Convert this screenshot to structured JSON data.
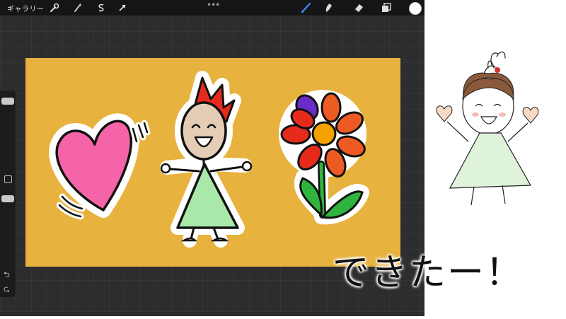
{
  "topbar": {
    "gallery_label": "ギャラリー",
    "dots": "•••",
    "left_tools": [
      "wrench-icon",
      "magic-wand-icon",
      "selection-icon",
      "transform-arrow-icon"
    ],
    "right_tools": [
      "brush-icon",
      "smudge-icon",
      "eraser-icon",
      "layers-icon",
      "color-swatch"
    ],
    "active_tool": "brush-icon",
    "current_color": "#ffffff"
  },
  "canvas": {
    "background": "#e8b23e",
    "stickers": [
      "heart",
      "happy-girl",
      "flower"
    ]
  },
  "colors": {
    "heart": "#f564a8",
    "hair": "#e62b1d",
    "dress": "#a9e8a8",
    "face": "#e5cdb5",
    "petals": "#ee5b22",
    "flower_center": "#f5a100",
    "leaves": "#2fb43d"
  },
  "caption": {
    "text": "できたー！"
  }
}
